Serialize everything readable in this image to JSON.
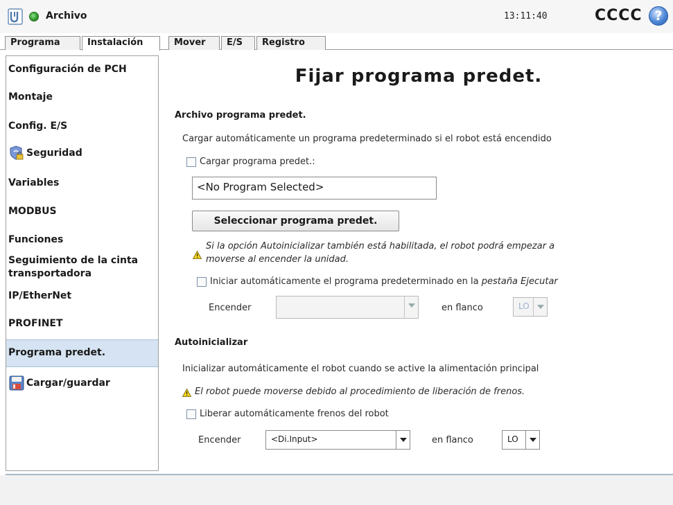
{
  "header": {
    "title": "Archivo",
    "clock": "13:11:40",
    "robot_name": "CCCC",
    "help_label": "?"
  },
  "tabs": [
    {
      "label": "Programa"
    },
    {
      "label": "Instalación"
    },
    {
      "label": "Mover"
    },
    {
      "label": "E/S"
    },
    {
      "label": "Registro"
    }
  ],
  "sidebar": {
    "items": [
      {
        "label": "Configuración de PCH"
      },
      {
        "label": "Montaje"
      },
      {
        "label": "Config. E/S"
      },
      {
        "label": "Seguridad",
        "icon": "shield-lock-icon"
      },
      {
        "label": "Variables"
      },
      {
        "label": "MODBUS"
      },
      {
        "label": "Funciones"
      },
      {
        "label": "Seguimiento de la cinta transportadora"
      },
      {
        "label": "IP/EtherNet"
      },
      {
        "label": "PROFINET"
      },
      {
        "label": "Programa predet."
      },
      {
        "label": "Cargar/guardar",
        "icon": "floppy-disk-icon"
      }
    ],
    "selected": "Programa predet."
  },
  "main": {
    "title": "Fijar programa predet.",
    "default_program": {
      "heading": "Archivo programa predet.",
      "description": "Cargar automáticamente un programa predeterminado si el robot está encendido",
      "load_checkbox_label": "Cargar programa predet.:",
      "program_field_value": "<No Program Selected>",
      "select_button_label": "Seleccionar programa predet.",
      "warning_line1": "Si la opción Autoinicializar también está habilitada, el robot podrá empezar a",
      "warning_line2": "moverse al encender la unidad.",
      "autostart_label_prefix": "Iniciar automáticamente el programa predeterminado en la ",
      "autostart_label_tab": "pestaña Ejecutar",
      "power_on_label": "Encender",
      "power_on_value": "",
      "edge_label": "en flanco",
      "edge_value": "LO"
    },
    "auto_init": {
      "heading": "Autoinicializar",
      "description": "Inicializar automáticamente el robot cuando se active la alimentación principal",
      "warning": "El robot puede moverse debido al procedimiento de liberación de frenos.",
      "brake_checkbox_label": "Liberar automáticamente frenos del robot",
      "power_on_label": "Encender",
      "power_on_value": "<Di.Input>",
      "edge_label": "en flanco",
      "edge_value": "LO"
    }
  },
  "colors": {
    "selected_item": "#d5e3f2",
    "status_green": "#2f9d2c",
    "help_blue": "#4d86d6",
    "warning_yellow": "#f2d21c"
  }
}
